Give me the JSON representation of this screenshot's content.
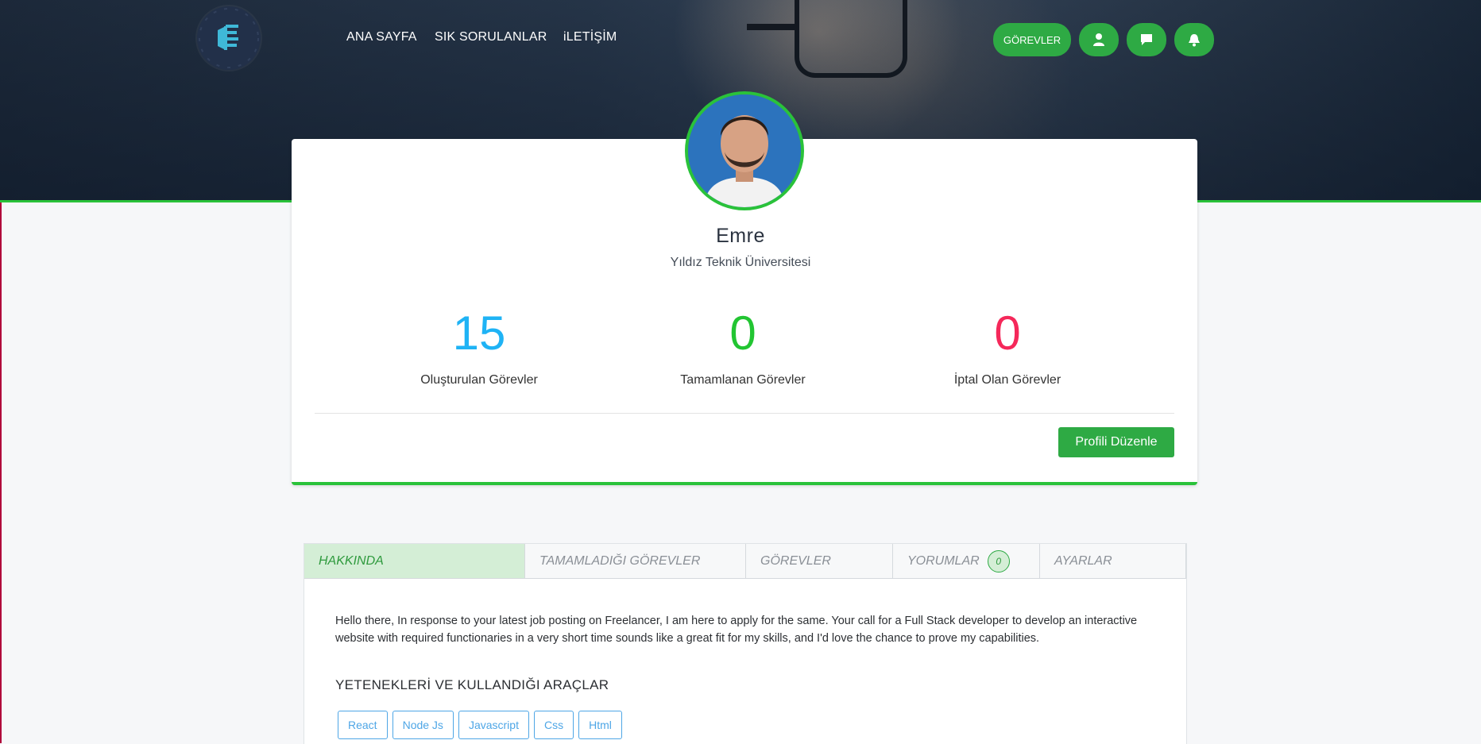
{
  "nav": {
    "links": [
      "ANA SAYFA",
      "SIK SORULANLAR",
      "iLETİŞİM"
    ],
    "tasks_button": "GÖREVLER",
    "icons": [
      "user-icon",
      "message-icon",
      "bell-icon"
    ]
  },
  "profile": {
    "name": "Emre",
    "school": "Yıldız Teknik Üniversitesi",
    "stats": [
      {
        "value": "15",
        "label": "Oluşturulan Görevler",
        "color": "#1fb3f5"
      },
      {
        "value": "0",
        "label": "Tamamlanan Görevler",
        "color": "#22c532"
      },
      {
        "value": "0",
        "label": "İptal Olan Görevler",
        "color": "#f5285a"
      }
    ],
    "edit_button": "Profili Düzenle"
  },
  "tabs": {
    "items": [
      "HAKKINDA",
      "TAMAMLADIĞI GÖREVLER",
      "GÖREVLER",
      "YORUMLAR",
      "AYARLAR"
    ],
    "comments_count": "0",
    "active": "HAKKINDA"
  },
  "about": {
    "text": "Hello there, In response to your latest job posting on Freelancer, I am here to apply for the same. Your call for a Full Stack developer to develop an interactive website with required functionaries in a very short time sounds like a great fit for my skills, and I'd love the chance to prove my capabilities.",
    "skills_title": "YETENEKLERİ VE KULLANDIĞI ARAÇLAR",
    "skills": [
      "React",
      "Node Js",
      "Javascript",
      "Css",
      "Html"
    ]
  },
  "colors": {
    "accent_green": "#2eaa44",
    "hero_border": "#2ac23a"
  }
}
